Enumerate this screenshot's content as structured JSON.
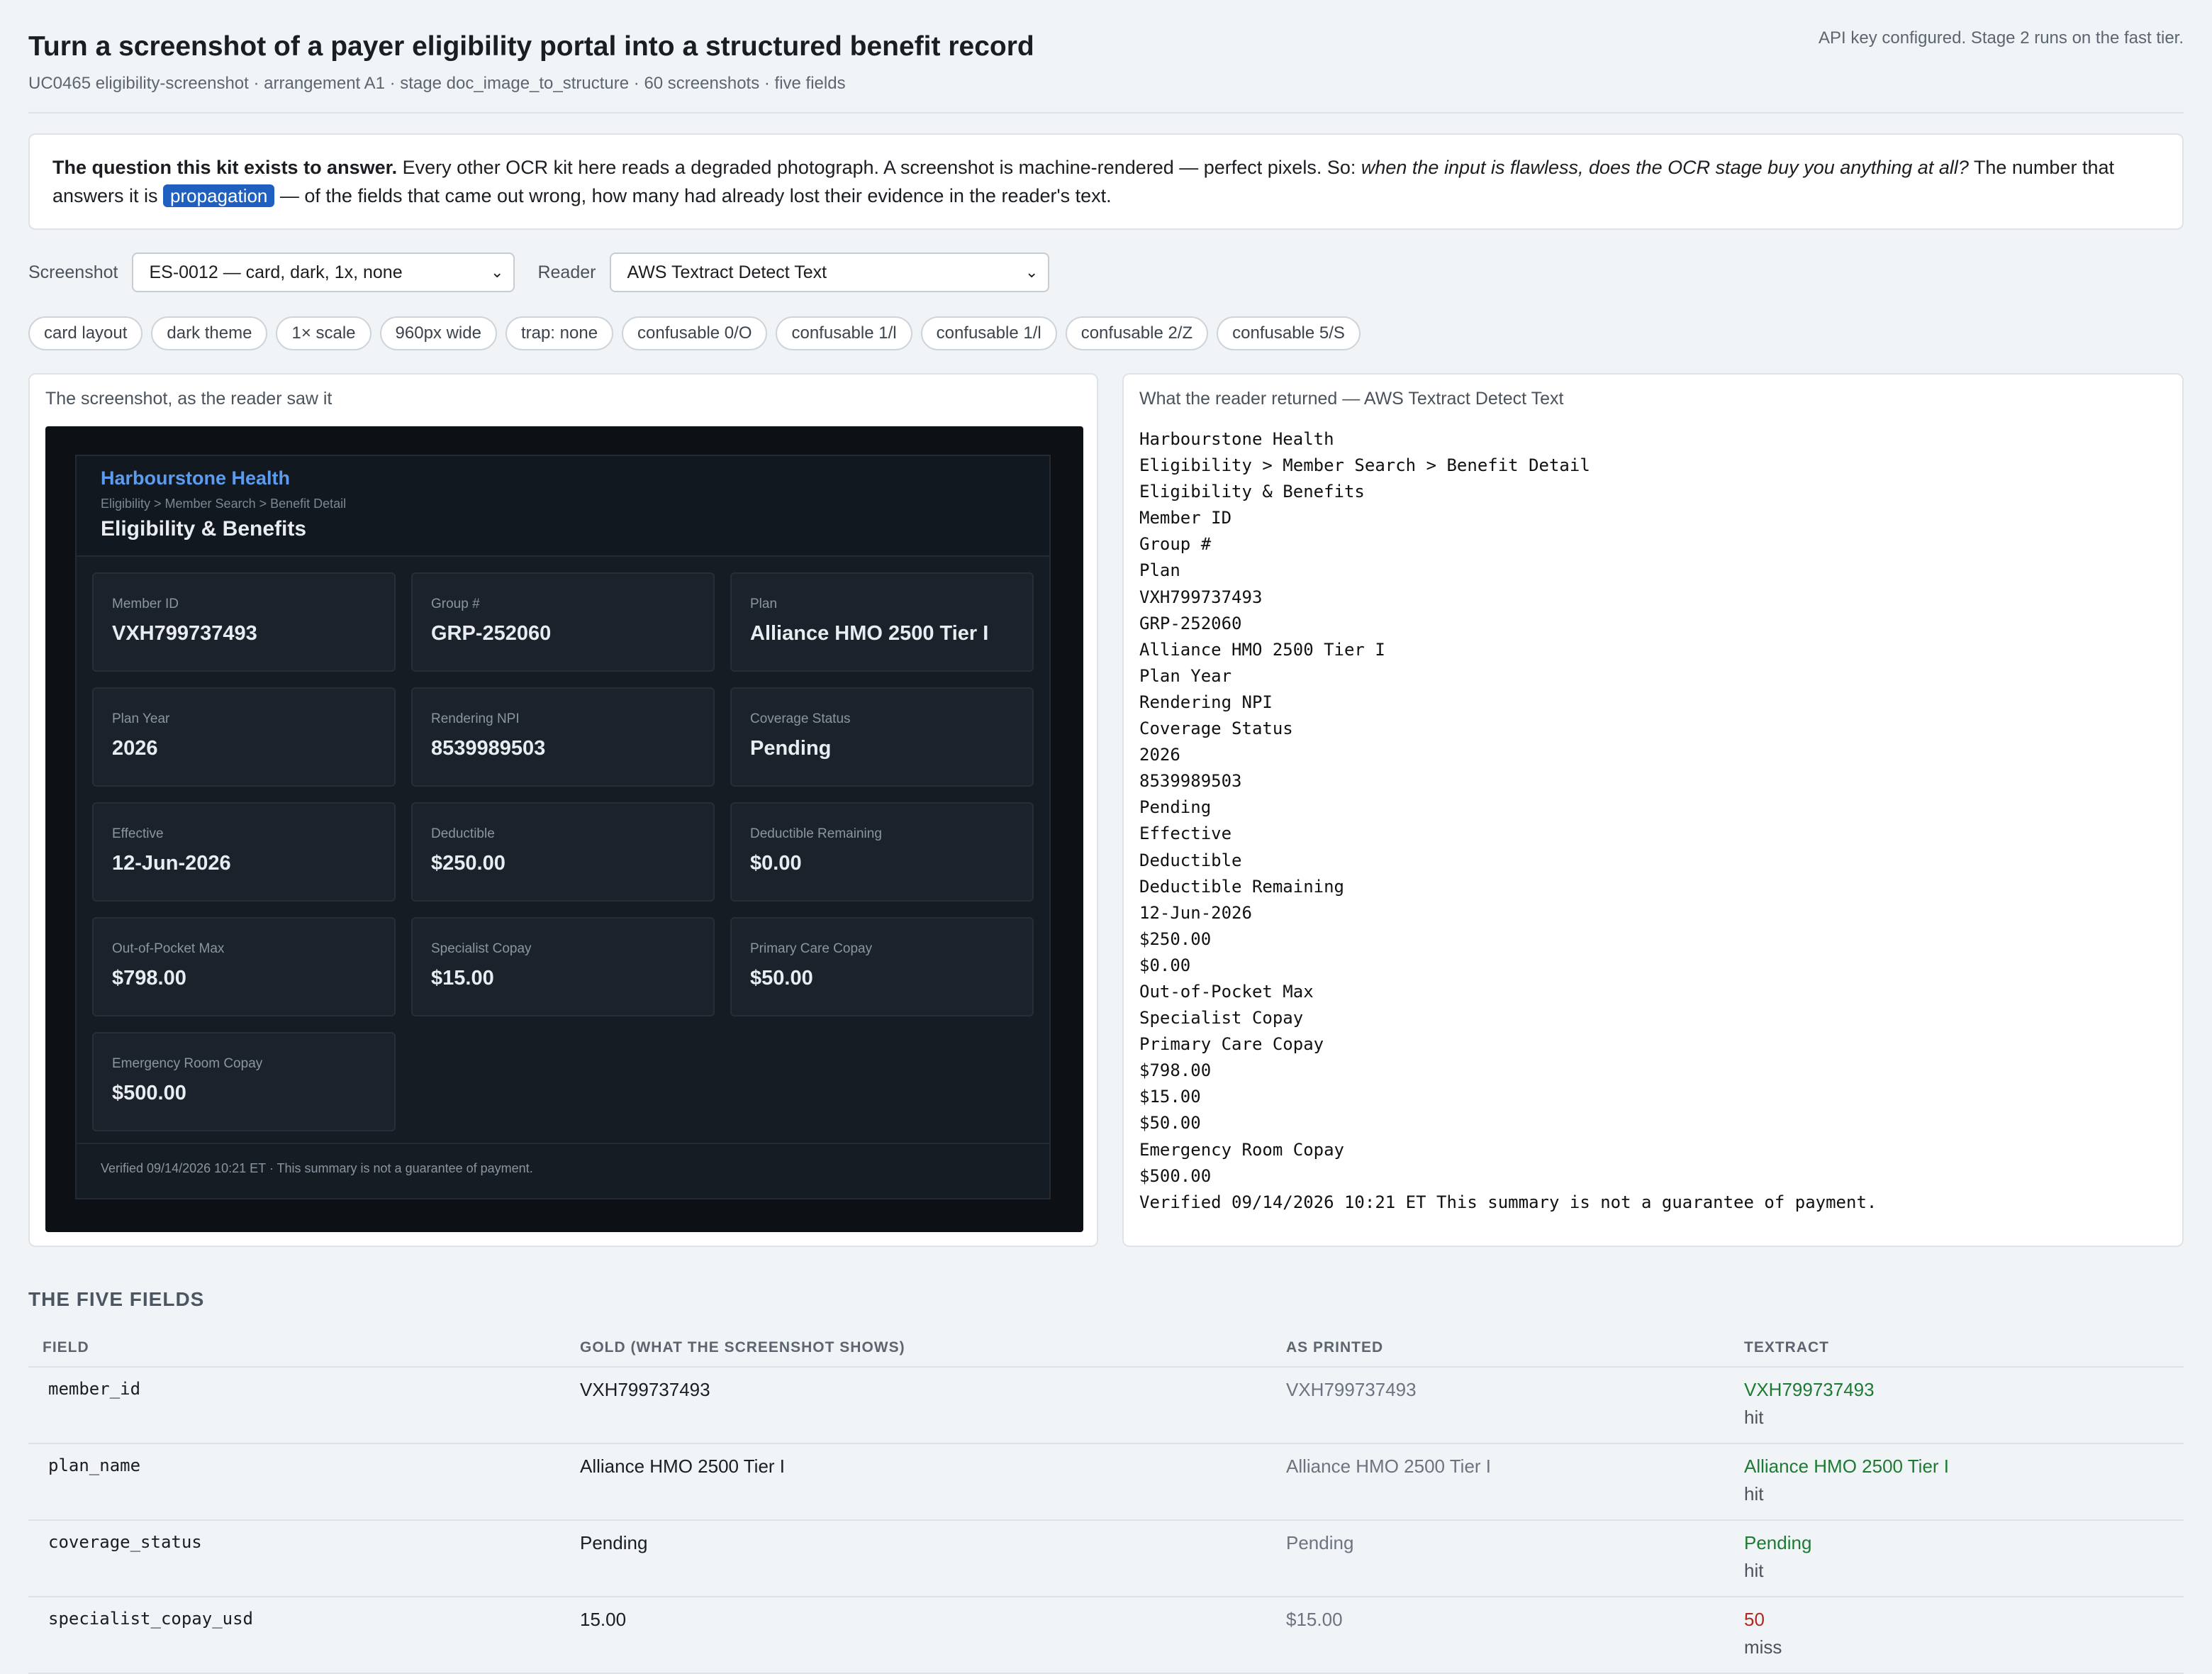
{
  "header": {
    "title": "Turn a screenshot of a payer eligibility portal into a structured benefit record",
    "subtitle": "UC0465 eligibility-screenshot · arrangement A1 · stage doc_image_to_structure · 60 screenshots · five fields",
    "api_note": "API key configured. Stage 2 runs on the fast tier."
  },
  "question": {
    "lead": "The question this kit exists to answer.",
    "text1": " Every other OCR kit here reads a degraded photograph. A screenshot is machine-rendered — perfect pixels. So: ",
    "italic": "when the input is flawless, does the OCR stage buy you anything at all?",
    "text2": " The number that answers it is ",
    "term": "propagation",
    "text3": " — of the fields that came out wrong, how many had already lost their evidence in the reader's text."
  },
  "controls": {
    "screenshot_label": "Screenshot",
    "screenshot_value": "ES-0012 — card, dark, 1x, none",
    "reader_label": "Reader",
    "reader_value": "AWS Textract Detect Text"
  },
  "chips": [
    "card layout",
    "dark theme",
    "1× scale",
    "960px wide",
    "trap: none",
    "confusable 0/O",
    "confusable 1/l",
    "confusable 1/l",
    "confusable 2/Z",
    "confusable 5/S"
  ],
  "left_panel": {
    "title": "The screenshot, as the reader saw it",
    "portal": {
      "brand": "Harbourstone Health",
      "crumb": "Eligibility > Member Search > Benefit Detail",
      "title": "Eligibility & Benefits",
      "fields": [
        {
          "label": "Member ID",
          "value": "VXH799737493"
        },
        {
          "label": "Group #",
          "value": "GRP-252060"
        },
        {
          "label": "Plan",
          "value": "Alliance HMO 2500 Tier I"
        },
        {
          "label": "Plan Year",
          "value": "2026"
        },
        {
          "label": "Rendering NPI",
          "value": "8539989503"
        },
        {
          "label": "Coverage Status",
          "value": "Pending"
        },
        {
          "label": "Effective",
          "value": "12-Jun-2026"
        },
        {
          "label": "Deductible",
          "value": "$250.00"
        },
        {
          "label": "Deductible Remaining",
          "value": "$0.00"
        },
        {
          "label": "Out-of-Pocket Max",
          "value": "$798.00"
        },
        {
          "label": "Specialist Copay",
          "value": "$15.00"
        },
        {
          "label": "Primary Care Copay",
          "value": "$50.00"
        },
        {
          "label": "Emergency Room Copay",
          "value": "$500.00"
        }
      ],
      "footer": "Verified 09/14/2026 10:21 ET · This summary is not a guarantee of payment."
    }
  },
  "right_panel": {
    "title": "What the reader returned — AWS Textract Detect Text",
    "ocr_text": "Harbourstone Health\nEligibility > Member Search > Benefit Detail\nEligibility & Benefits\nMember ID\nGroup #\nPlan\nVXH799737493\nGRP-252060\nAlliance HMO 2500 Tier I\nPlan Year\nRendering NPI\nCoverage Status\n2026\n8539989503\nPending\nEffective\nDeductible\nDeductible Remaining\n12-Jun-2026\n$250.00\n$0.00\nOut-of-Pocket Max\nSpecialist Copay\nPrimary Care Copay\n$798.00\n$15.00\n$50.00\nEmergency Room Copay\n$500.00\nVerified 09/14/2026 10:21 ET This summary is not a guarantee of payment."
  },
  "fields_table": {
    "section_title": "THE FIVE FIELDS",
    "headers": [
      "FIELD",
      "GOLD (WHAT THE SCREENSHOT SHOWS)",
      "AS PRINTED",
      "TEXTRACT"
    ],
    "rows": [
      {
        "field": "member_id",
        "gold": "VXH799737493",
        "printed": "VXH799737493",
        "value": "VXH799737493",
        "verdict": "hit"
      },
      {
        "field": "plan_name",
        "gold": "Alliance HMO 2500 Tier I",
        "printed": "Alliance HMO 2500 Tier I",
        "value": "Alliance HMO 2500 Tier I",
        "verdict": "hit"
      },
      {
        "field": "coverage_status",
        "gold": "Pending",
        "printed": "Pending",
        "value": "Pending",
        "verdict": "hit"
      },
      {
        "field": "specialist_copay_usd",
        "gold": "15.00",
        "printed": "$15.00",
        "value": "50",
        "verdict": "miss"
      }
    ]
  },
  "colors": {
    "accent": "#1f5fbf",
    "hit": "#1c7a33",
    "miss": "#b3261e",
    "brand": "#5b9cf0"
  }
}
